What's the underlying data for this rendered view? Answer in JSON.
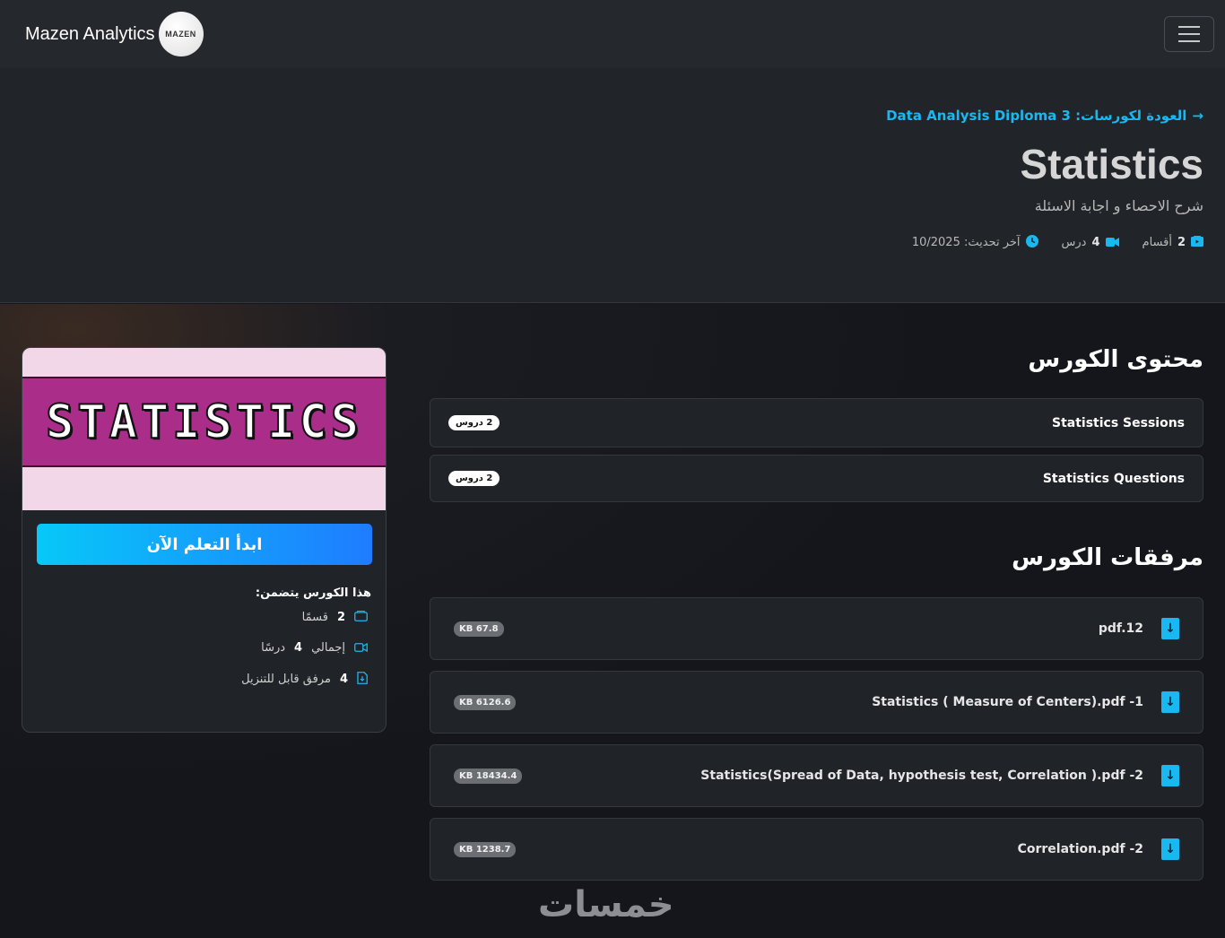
{
  "navbar": {
    "brand_text": "Mazen Analytics",
    "logo_text": "MAZEN"
  },
  "hero": {
    "back_link": "العودة لكورسات: Data Analysis Diploma 3",
    "title": "Statistics",
    "subtitle": "شرح الاحصاء و اجابة الاسئلة",
    "meta": {
      "sections_count": "2",
      "sections_label": "أقسام",
      "lessons_count": "4",
      "lessons_label": "درس",
      "updated_label": "آخر تحديث: 10/2025"
    }
  },
  "content": {
    "heading": "محتوى الكورس",
    "sections": [
      {
        "title": "Statistics Sessions",
        "badge": "2 دروس"
      },
      {
        "title": "Statistics Questions",
        "badge": "2 دروس"
      }
    ]
  },
  "attachments": {
    "heading": "مرفقات الكورس",
    "items": [
      {
        "name": "pdf.12",
        "size": "KB 67.8"
      },
      {
        "name": "Statistics ( Measure of Centers).pdf -1",
        "size": "KB 6126.6"
      },
      {
        "name": "Statistics(Spread of Data, hypothesis test, Correlation ).pdf -2",
        "size": "KB 18434.4"
      },
      {
        "name": "Correlation.pdf -2",
        "size": "KB 1238.7"
      }
    ]
  },
  "sidebar": {
    "image_text": "STATISTICS",
    "cta_label": "ابدأ التعلم الآن",
    "includes_title": "هذا الكورس يتضمن:",
    "includes": [
      {
        "count": "2",
        "label": "قسمًا"
      },
      {
        "prefix": "إجمالي",
        "count": "4",
        "label": "درسًا"
      },
      {
        "count": "4",
        "label": "مرفق قابل للتنزيل"
      }
    ]
  },
  "watermark": "خمسات",
  "colors": {
    "accent": "#1ab8f0",
    "navbar_bg": "#25282d",
    "hero_bg": "#212428",
    "card_bg": "#202327",
    "cta_gradient_start": "#07c8f8",
    "cta_gradient_end": "#1f7cff"
  },
  "icons": {
    "menu": "hamburger-icon",
    "back": "arrow-right-icon",
    "sections": "folder-icon",
    "lessons": "video-icon",
    "updated": "clock-icon",
    "file": "file-download-icon"
  }
}
